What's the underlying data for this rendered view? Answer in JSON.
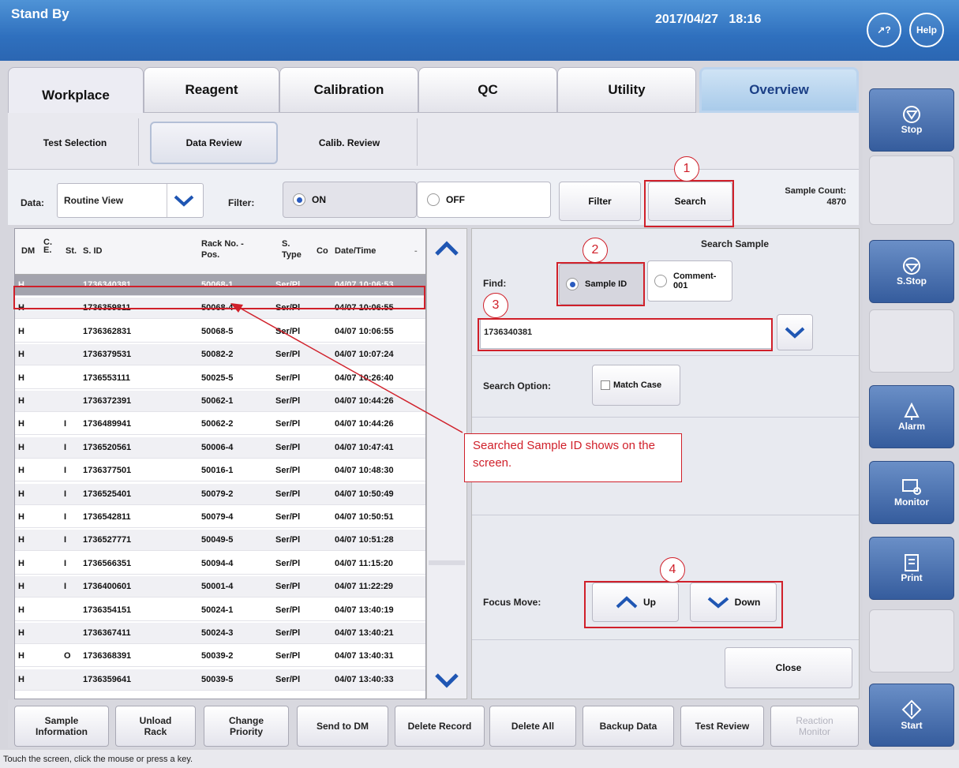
{
  "app": {
    "title": "Stand By",
    "date": "2017/04/27",
    "time": "18:16",
    "help_label": "Help",
    "pointer_help_label": "?"
  },
  "tabs": [
    {
      "label": "Workplace"
    },
    {
      "label": "Reagent"
    },
    {
      "label": "Calibration"
    },
    {
      "label": "QC"
    },
    {
      "label": "Utility"
    },
    {
      "label": "Overview"
    }
  ],
  "subtabs": [
    {
      "label": "Test Selection"
    },
    {
      "label": "Data Review"
    },
    {
      "label": "Calib. Review"
    }
  ],
  "toolbar": {
    "data_label": "Data:",
    "data_value": "Routine View",
    "filter_label": "Filter:",
    "on_label": "ON",
    "off_label": "OFF",
    "filter_button": "Filter",
    "search_button": "Search",
    "sample_count_label": "Sample Count:",
    "sample_count_value": "4870"
  },
  "table": {
    "headers": {
      "dm": "DM",
      "ce": "C.\nE.",
      "st": "St.",
      "sid": "S. ID",
      "rack": "Rack No. -\nPos.",
      "stype": "S.\nType",
      "co": "Co",
      "datetime": "Date/Time"
    },
    "rows": [
      {
        "dm": "H",
        "ce": "",
        "st": "",
        "sid": "1736340381",
        "rack": "50068-1",
        "stype": "Ser/Pl",
        "dt": "04/07 10:06:53"
      },
      {
        "dm": "H",
        "ce": "",
        "st": "",
        "sid": "1736359811",
        "rack": "50068-4",
        "stype": "Ser/Pl",
        "dt": "04/07 10:06:55"
      },
      {
        "dm": "H",
        "ce": "",
        "st": "",
        "sid": "1736362831",
        "rack": "50068-5",
        "stype": "Ser/Pl",
        "dt": "04/07 10:06:55"
      },
      {
        "dm": "H",
        "ce": "",
        "st": "",
        "sid": "1736379531",
        "rack": "50082-2",
        "stype": "Ser/Pl",
        "dt": "04/07 10:07:24"
      },
      {
        "dm": "H",
        "ce": "",
        "st": "",
        "sid": "1736553111",
        "rack": "50025-5",
        "stype": "Ser/Pl",
        "dt": "04/07 10:26:40"
      },
      {
        "dm": "H",
        "ce": "",
        "st": "",
        "sid": "1736372391",
        "rack": "50062-1",
        "stype": "Ser/Pl",
        "dt": "04/07 10:44:26"
      },
      {
        "dm": "H",
        "ce": "I",
        "st": "",
        "sid": "1736489941",
        "rack": "50062-2",
        "stype": "Ser/Pl",
        "dt": "04/07 10:44:26"
      },
      {
        "dm": "H",
        "ce": "I",
        "st": "",
        "sid": "1736520561",
        "rack": "50006-4",
        "stype": "Ser/Pl",
        "dt": "04/07 10:47:41"
      },
      {
        "dm": "H",
        "ce": "I",
        "st": "",
        "sid": "1736377501",
        "rack": "50016-1",
        "stype": "Ser/Pl",
        "dt": "04/07 10:48:30"
      },
      {
        "dm": "H",
        "ce": "I",
        "st": "",
        "sid": "1736525401",
        "rack": "50079-2",
        "stype": "Ser/Pl",
        "dt": "04/07 10:50:49"
      },
      {
        "dm": "H",
        "ce": "I",
        "st": "",
        "sid": "1736542811",
        "rack": "50079-4",
        "stype": "Ser/Pl",
        "dt": "04/07 10:50:51"
      },
      {
        "dm": "H",
        "ce": "I",
        "st": "",
        "sid": "1736527771",
        "rack": "50049-5",
        "stype": "Ser/Pl",
        "dt": "04/07 10:51:28"
      },
      {
        "dm": "H",
        "ce": "I",
        "st": "",
        "sid": "1736566351",
        "rack": "50094-4",
        "stype": "Ser/Pl",
        "dt": "04/07 11:15:20"
      },
      {
        "dm": "H",
        "ce": "I",
        "st": "",
        "sid": "1736400601",
        "rack": "50001-4",
        "stype": "Ser/Pl",
        "dt": "04/07 11:22:29"
      },
      {
        "dm": "H",
        "ce": "",
        "st": "",
        "sid": "1736354151",
        "rack": "50024-1",
        "stype": "Ser/Pl",
        "dt": "04/07 13:40:19"
      },
      {
        "dm": "H",
        "ce": "",
        "st": "",
        "sid": "1736367411",
        "rack": "50024-3",
        "stype": "Ser/Pl",
        "dt": "04/07 13:40:21"
      },
      {
        "dm": "H",
        "ce": "O",
        "st": "",
        "sid": "1736368391",
        "rack": "50039-2",
        "stype": "Ser/Pl",
        "dt": "04/07 13:40:31"
      },
      {
        "dm": "H",
        "ce": "",
        "st": "",
        "sid": "1736359641",
        "rack": "50039-5",
        "stype": "Ser/Pl",
        "dt": "04/07 13:40:33"
      }
    ]
  },
  "search_panel": {
    "title": "Search Sample",
    "find_label": "Find:",
    "option_sample_id": "Sample ID",
    "option_comment": "Comment-\n001",
    "input_value": "1736340381",
    "search_option_label": "Search Option:",
    "match_case_label": "Match Case",
    "focus_move_label": "Focus Move:",
    "up_label": "Up",
    "down_label": "Down",
    "close_label": "Close"
  },
  "annotations": {
    "callout_text": "Searched Sample ID shows on the screen.",
    "steps": [
      "1",
      "2",
      "3",
      "4"
    ]
  },
  "bottom_buttons": [
    {
      "label": "Sample\nInformation"
    },
    {
      "label": "Unload\nRack"
    },
    {
      "label": "Change\nPriority"
    },
    {
      "label": "Send to DM"
    },
    {
      "label": "Delete Record"
    },
    {
      "label": "Delete All"
    },
    {
      "label": "Backup Data"
    },
    {
      "label": "Test Review"
    },
    {
      "label": "Reaction\nMonitor"
    }
  ],
  "side_buttons": [
    {
      "label": "Stop"
    },
    {
      "label": "S.Stop"
    },
    {
      "label": "Alarm"
    },
    {
      "label": "Monitor"
    },
    {
      "label": "Print"
    },
    {
      "label": "Start"
    }
  ],
  "status": {
    "message": "Touch the screen, click the mouse or press a key."
  },
  "colors": {
    "titlebar": "#2f70be",
    "annotation_red": "#d0202a",
    "selected_row": "#a3a3ad",
    "side_button": "#355c9d"
  }
}
